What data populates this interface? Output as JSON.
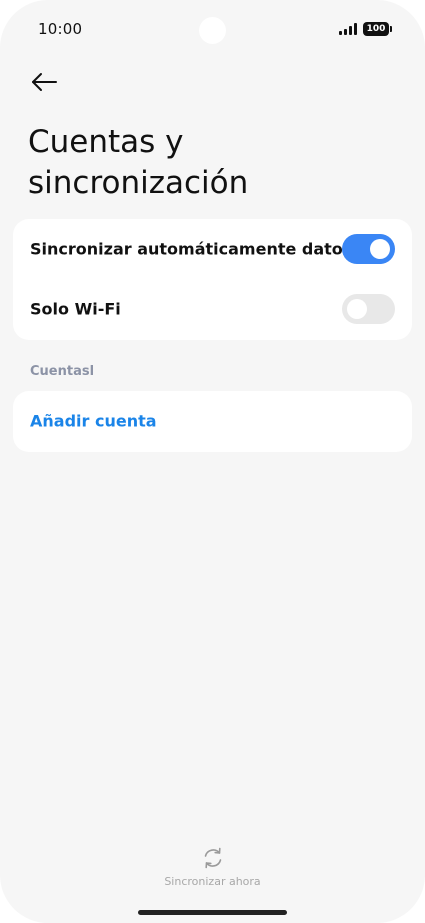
{
  "status_bar": {
    "time": "10:00",
    "battery": "100",
    "signal_icon": "signal-icon"
  },
  "header": {
    "back_icon": "arrow-left-icon",
    "title": "Cuentas y sincronización"
  },
  "sync_settings": {
    "auto_sync": {
      "label": "Sincronizar automáticamente datos",
      "enabled": true
    },
    "wifi_only": {
      "label": "Solo Wi-Fi",
      "enabled": false
    }
  },
  "accounts": {
    "section_title": "Cuentasl",
    "add_account_label": "Añadir cuenta"
  },
  "footer": {
    "sync_now_label": "Sincronizar ahora",
    "sync_icon": "sync-icon"
  },
  "colors": {
    "accent": "#3a86f5",
    "link": "#1a84e8",
    "background": "#f6f6f6",
    "card": "#ffffff",
    "section_header": "#8c93a6"
  }
}
